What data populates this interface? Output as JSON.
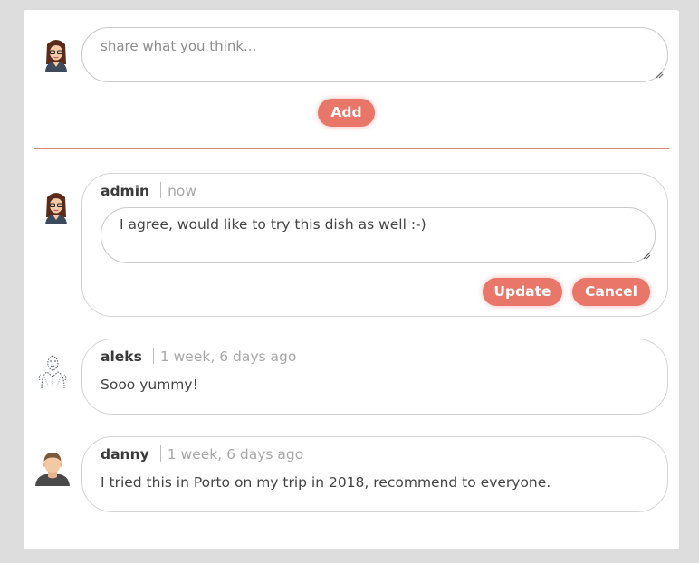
{
  "new_comment": {
    "placeholder": "share what you think...",
    "add_label": "Add"
  },
  "editing_comment": {
    "author": "admin",
    "time": "now",
    "text": "I agree, would like to try this dish as well :-)",
    "update_label": "Update",
    "cancel_label": "Cancel"
  },
  "comments": [
    {
      "author": "aleks",
      "time": "1 week, 6 days ago",
      "text": "Sooo yummy!",
      "avatar_icon": "sketch-avatar-icon"
    },
    {
      "author": "danny",
      "time": "1 week, 6 days ago",
      "text": "I tried this in Porto on my trip in 2018, recommend to everyone.",
      "avatar_icon": "man-avatar-icon"
    }
  ],
  "colors": {
    "accent": "#e8776a",
    "divider": "#d98a7c",
    "background": "#dcdddc",
    "card": "#ffffff"
  }
}
